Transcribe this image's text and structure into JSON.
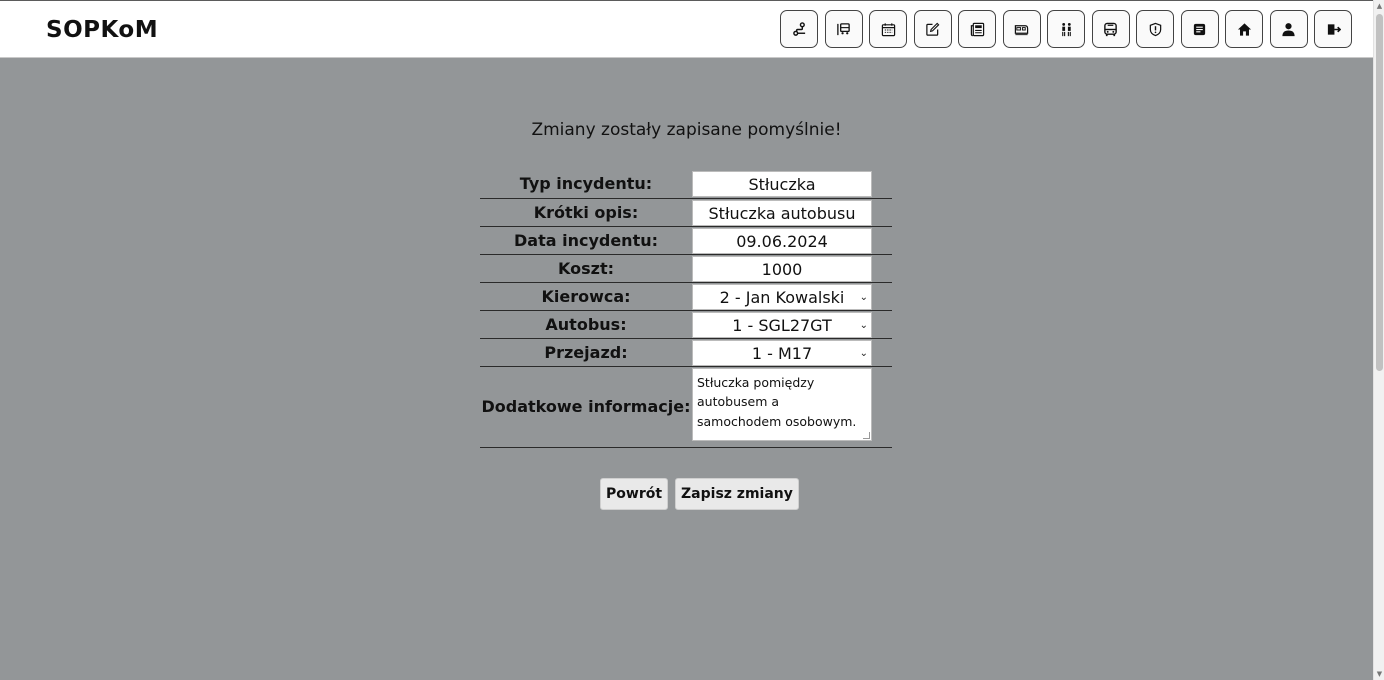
{
  "app": {
    "logo": "SOPKoM"
  },
  "nav": [
    {
      "name": "route-icon"
    },
    {
      "name": "bus-stop-icon"
    },
    {
      "name": "calendar-icon"
    },
    {
      "name": "edit-icon"
    },
    {
      "name": "newspaper-icon"
    },
    {
      "name": "bus-side-icon"
    },
    {
      "name": "passengers-icon"
    },
    {
      "name": "bus-front-icon"
    },
    {
      "name": "shield-icon"
    },
    {
      "name": "note-icon"
    },
    {
      "name": "home-icon"
    },
    {
      "name": "user-icon"
    },
    {
      "name": "logout-icon"
    }
  ],
  "message": "Zmiany zostały zapisane pomyślnie!",
  "form": {
    "typ": {
      "label": "Typ incydentu:",
      "value": "Stłuczka"
    },
    "opis": {
      "label": "Krótki opis:",
      "value": "Stłuczka autobusu"
    },
    "data": {
      "label": "Data incydentu:",
      "value": "09.06.2024"
    },
    "koszt": {
      "label": "Koszt:",
      "value": "1000"
    },
    "kierowca": {
      "label": "Kierowca:",
      "value": "2 - Jan Kowalski"
    },
    "autobus": {
      "label": "Autobus:",
      "value": "1 - SGL27GT"
    },
    "przejazd": {
      "label": "Przejazd:",
      "value": "1 - M17"
    },
    "info": {
      "label": "Dodatkowe informacje:",
      "value": "Stłuczka pomiędzy autobusem a samochodem osobowym."
    }
  },
  "buttons": {
    "back": "Powrót",
    "save": "Zapisz zmiany"
  }
}
